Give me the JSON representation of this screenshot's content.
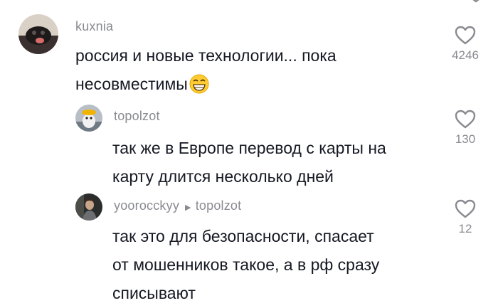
{
  "comments": [
    {
      "username": "kuxnia",
      "text_lines": [
        "россия и новые технологии... пока",
        "несовместимы"
      ],
      "emoji": "grinning-face-emoji",
      "likes": "4246"
    },
    {
      "username": "topolzot",
      "text_lines": [
        "так же в Европе перевод с карты на",
        "карту длится несколько дней"
      ],
      "likes": "130"
    },
    {
      "username": "yoorocckyy",
      "reply_to": "topolzot",
      "text_lines": [
        "так это для безопасности, спасает",
        "от мошенников такое, а в рф сразу",
        "списывают"
      ],
      "likes": "12"
    }
  ],
  "icons": {
    "like": "heart-outline-icon",
    "reply_arrow": "triangle-right-icon"
  },
  "colors": {
    "text": "#161823",
    "muted": "#8a8b91"
  }
}
